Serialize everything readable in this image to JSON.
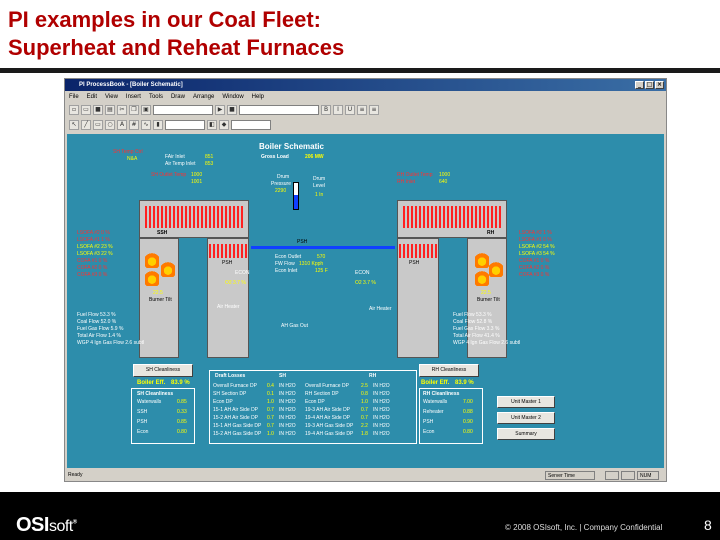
{
  "slide": {
    "title_line1": "PI examples in our Coal Fleet:",
    "title_line2": "Superheat and Reheat Furnaces",
    "logo_main": "OSI",
    "logo_soft": "soft",
    "logo_tm": "®",
    "copyright": "© 2008 OSIsoft, Inc. | Company Confidential",
    "page_number": "8"
  },
  "window": {
    "title": "PI ProcessBook - [Boiler Schematic]",
    "menu": [
      "File",
      "Edit",
      "View",
      "Insert",
      "Tools",
      "Draw",
      "Arrange",
      "Window",
      "Help"
    ],
    "status_ready": "Ready",
    "status_time": "Server Time",
    "status_num": "NUM"
  },
  "schematic": {
    "title": "Boiler Schematic",
    "gross_load_label": "Gross Load",
    "gross_load_value": "206 MW",
    "sh_temp_label": "SH Temp Ctrl",
    "sh_temp_value": "N&A",
    "flow_air_label": "FAir Inlet",
    "flow_air_value": "851",
    "ph_air_label": "Air Temp Inlet",
    "ph_air_value": "853",
    "sh_outlet_label": "SH Outlet Temp",
    "sh_outlet_value": "1000",
    "sh_outlet_value2": "1001",
    "drum_label1": "Drum",
    "drum_label2": "Pressure",
    "drum_value": "2290",
    "drum_level_label": "Drum",
    "drum_level_label2": "Level",
    "drum_level_value": "1 In",
    "econ_label": "Econ Outlet",
    "econ_value": "570",
    "fw_flow_label": "FW Flow",
    "fw_flow_value": "1310 Kpph",
    "econ_inlet_label": "Econ Inlet",
    "econ_inlet_value": "125 F",
    "rh_outlet_label": "RH Outlet Temp",
    "rh_outlet_value": "1000",
    "rh_inlet_label": "RH Inlet",
    "rh_inlet_value": "640",
    "psh_left": "PSH",
    "psh_center": "PSH",
    "psh_right": "PSH",
    "ssh": "SSH",
    "rh": "RH",
    "econ_left": "ECON",
    "econ_right": "ECON",
    "burner_left": "Burner Tilt",
    "burner_right": "Burner Tilt",
    "air_heater_left": "Air Heater",
    "air_heater_right": "Air Heater",
    "o2_left": "O2  3.7 %",
    "o2_right": "O2  3.7 %",
    "ah_gas_out": "AH Gas Out",
    "tilt_left": "22.5",
    "tilt_right": "22.5",
    "left_list": [
      "LSOFA #2  0 %",
      "LSOFA #1  1 %",
      "LSOFA #2  23 %",
      "LSOFA #3  22 %",
      "COFA #1  0 %",
      "COFA #2  0 %",
      "COFA #3  0 %"
    ],
    "right_list": [
      "LSOFA #2  1 %",
      "LSOFA #1  0 %",
      "LSOFA #2  54 %",
      "LSOFA #3  54 %",
      "COFA #1  0 %",
      "COFA #2  0 %",
      "COFA #3  0 %"
    ],
    "left_fuel": [
      "Fuel Flow  53.3 %",
      "Coal Flow  52.0 %",
      "Fuel Gas Flow  5.9 %",
      "Total Air Flow  1.4 %",
      "WGP 4 Ign Gas Flow  2.6 subtl"
    ],
    "right_fuel": [
      "Fuel Flow  53.3 %",
      "Coal Flow  52.8 %",
      "Fuel Gas Flow  3.3 %",
      "Total Air Flow  41.4 %",
      "WGP 4 Ign Gas Flow  2.6 subtl"
    ],
    "sh_cleanliness_btn": "SH Cleanliness",
    "rh_cleanliness_btn": "RH Cleanliness",
    "boiler_eff_label": "Boiler Eff.",
    "boiler_eff_value": "83.9 %",
    "boiler_eff_value_right": "83.9 %",
    "sh_clean_title": "SH Cleanliness",
    "sh_clean_rows": [
      [
        "Waterwalls",
        "0.85"
      ],
      [
        "SSH",
        "0.33"
      ],
      [
        "PSH",
        "0.85"
      ],
      [
        "Econ",
        "0.80"
      ]
    ],
    "rh_clean_title": "RH Cleanliness",
    "rh_clean_rows": [
      [
        "Waterwalls",
        "7.00"
      ],
      [
        "Reheater",
        "0.88"
      ],
      [
        "PSH",
        "0.90"
      ],
      [
        "Econ",
        "0.80"
      ]
    ],
    "draft_title": "Draft Losses",
    "draft_sh": "SH",
    "draft_rh": "RH",
    "draft_left": [
      [
        "Overall Furnace DP",
        "0.4",
        "IN H2O"
      ],
      [
        "SH Section DP",
        "0.1",
        "IN H2O"
      ],
      [
        "Econ DP",
        "1.0",
        "IN H2O"
      ],
      [
        "15-1 AH Air Side DP",
        "0.7",
        "IN H2O"
      ],
      [
        "15-2 AH Air Side DP",
        "0.7",
        "IN H2O"
      ],
      [
        "15-1 AH Gas Side DP",
        "0.7",
        "IN H2O"
      ],
      [
        "15-2 AH Gas Side DP",
        "1.0",
        "IN H2O"
      ]
    ],
    "draft_right": [
      [
        "Overall Furnace DP",
        "2.5",
        "IN H2O"
      ],
      [
        "RH Section DP",
        "0.8",
        "IN H2O"
      ],
      [
        "Econ DP",
        "1.0",
        "IN H2O"
      ],
      [
        "19-3 AH Air Side DP",
        "0.7",
        "IN H2O"
      ],
      [
        "19-4 AH Air Side DP",
        "0.7",
        "IN H2O"
      ],
      [
        "19-3 AH Gas Side DP",
        "2.2",
        "IN H2O"
      ],
      [
        "19-4 AH Gas Side DP",
        "1.8",
        "IN H2O"
      ]
    ],
    "unit_master1": "Unit Master 1",
    "unit_master2": "Unit Master 2",
    "summary": "Summary"
  }
}
